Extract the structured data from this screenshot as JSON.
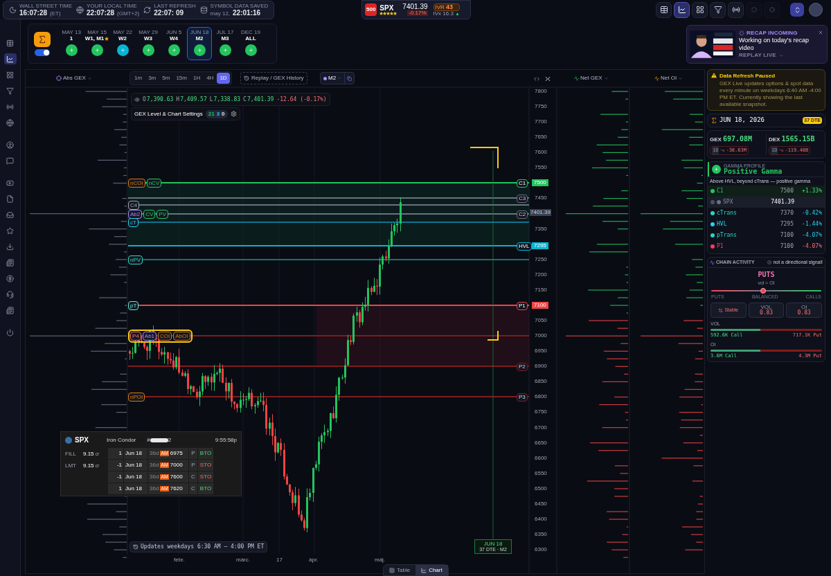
{
  "status_bar": {
    "clocks": [
      {
        "label": "WALL STREET TIME",
        "time": "16:07:28",
        "zone": "(ET)"
      },
      {
        "label": "YOUR LOCAL TIME",
        "time": "22:07:28",
        "zone": "(GMT+2)"
      },
      {
        "label": "LAST REFRESH",
        "time": "22:07: 09"
      },
      {
        "label": "SYMBOL DATA SAVED",
        "zone": "may 12,",
        "time": "22:01:16"
      }
    ]
  },
  "ticker": {
    "badge": "500",
    "symbol": "SPX",
    "stars": 5,
    "price": "7401.39",
    "change": "-0.17%",
    "ivr_label": "IVR",
    "ivr": "43",
    "ivx": "IVx 16.3",
    "ivx_arrow": "▲"
  },
  "toolbar": {
    "buttons": [
      {
        "selected": false,
        "disabled": false
      },
      {
        "selected": true,
        "disabled": false
      },
      {
        "selected": false,
        "disabled": false
      },
      {
        "selected": false,
        "disabled": false
      },
      {
        "selected": false,
        "disabled": false
      },
      {
        "selected": false,
        "disabled": true
      },
      {
        "selected": false,
        "disabled": true
      }
    ]
  },
  "sidebar": {
    "groups": [
      {
        "items": [
          {
            "selected": false
          },
          {
            "selected": true
          },
          {
            "selected": false
          },
          {
            "selected": false
          },
          {
            "selected": false
          },
          {
            "selected": false
          }
        ]
      },
      {
        "items": [
          {
            "selected": false
          },
          {
            "selected": false
          }
        ]
      },
      {
        "items": [
          {
            "selected": false
          },
          {
            "selected": false
          },
          {
            "selected": false
          },
          {
            "selected": false
          },
          {
            "selected": false
          },
          {
            "selected": false
          },
          {
            "selected": false
          },
          {
            "selected": false
          },
          {
            "selected": false
          }
        ]
      },
      {
        "items": [
          {
            "selected": false
          }
        ]
      }
    ]
  },
  "expiry_bar": {
    "toggle": {
      "on": true
    },
    "expiries": [
      {
        "date": "MAY 13",
        "label": "1",
        "starred": false,
        "selected": false,
        "color": "#22c55e"
      },
      {
        "date": "MAY 15",
        "label": "W1, M1",
        "starred": true,
        "selected": false,
        "color": "#22c55e"
      },
      {
        "date": "MAY 22",
        "label": "W2",
        "starred": false,
        "selected": false,
        "color": "#06b6d4"
      },
      {
        "date": "MAY 29",
        "label": "W3",
        "starred": false,
        "selected": false,
        "color": "#22c55e"
      },
      {
        "date": "JUN 5",
        "label": "W4",
        "starred": false,
        "selected": false,
        "color": "#22c55e"
      },
      {
        "date": "JUN 18",
        "label": "M2",
        "starred": false,
        "selected": true,
        "color": "#22c55e"
      },
      {
        "date": "JUL 17",
        "label": "M3",
        "starred": false,
        "selected": false,
        "color": "#22c55e"
      },
      {
        "date": "DEC 19",
        "label": "ALL",
        "starred": false,
        "selected": false,
        "color": "#22c55e"
      }
    ]
  },
  "recap": {
    "title": "RECAP INCOMING",
    "message": "Working on today's recap video",
    "link": "REPLAY LIVE →"
  },
  "chart": {
    "left_header": "Abs GEX",
    "timeframes": [
      {
        "label": "1m",
        "selected": false
      },
      {
        "label": "3m",
        "selected": false
      },
      {
        "label": "5m",
        "selected": false
      },
      {
        "label": "15m",
        "selected": false
      },
      {
        "label": "1H",
        "selected": false
      },
      {
        "label": "4H",
        "selected": false
      },
      {
        "label": "1D",
        "selected": true
      }
    ],
    "replay": "Replay / GEX History",
    "series": "M2",
    "right_headers": [
      "Net GEX",
      "Net OI"
    ],
    "ohlc": [
      {
        "key": "O",
        "value": "7,390.63"
      },
      {
        "key": "H",
        "value": "7,409.57"
      },
      {
        "key": "L",
        "value": "7,338.83"
      },
      {
        "key": "C",
        "value": "7,401.39"
      }
    ],
    "change": "-12.64 (-0.17%)",
    "settings": {
      "label": "GEX Level & Chart Settings",
      "counts": [
        {
          "value": "21",
          "kind": "green"
        },
        {
          "value": "3",
          "kind": "blue"
        },
        {
          "value": "0",
          "kind": "plain"
        }
      ]
    },
    "price_axis": [
      "7800",
      "7750",
      "7700",
      "7650",
      "7600",
      "7550",
      "7450",
      "7350",
      "7250",
      "7200",
      "7150",
      "7050",
      "7000",
      "6950",
      "6900",
      "6850",
      "6800",
      "6750",
      "6700",
      "6650",
      "6600",
      "6550",
      "6500",
      "6450",
      "6400",
      "6350",
      "6300"
    ],
    "current_price": "7401.39",
    "levels": [
      {
        "label": "C1",
        "price": "7500",
        "color": "#22c55e",
        "highlighted": false,
        "tags": [
          {
            "text": "nCOI",
            "color": "#d97706"
          },
          {
            "text": "nCV",
            "color": "#22c55e"
          }
        ]
      },
      {
        "label": "C3",
        "color": "#6b7280"
      },
      {
        "color": "#6b7280",
        "highlighted": false,
        "tags": [
          {
            "text": "C4",
            "color": "#9ca3af"
          }
        ]
      },
      {
        "label": "C2",
        "color": "#6b7280",
        "highlighted": false,
        "tags": [
          {
            "text": "Ab2",
            "color": "#a78bfa"
          },
          {
            "text": "CV",
            "color": "#22c55e"
          },
          {
            "text": "PV",
            "color": "#22c55e"
          }
        ]
      },
      {
        "color": "#0e7490",
        "highlighted": false,
        "tags": [
          {
            "text": "cT",
            "color": "#22d3ee"
          }
        ]
      },
      {
        "label": "HVL",
        "price": "7295",
        "color": "#06b6d4"
      },
      {
        "color": "#0f766e",
        "highlighted": false,
        "tags": [
          {
            "text": "nPV",
            "color": "#2dd4bf"
          }
        ]
      },
      {
        "label": "P1",
        "price": "7100",
        "color": "#ef4444",
        "highlighted": false,
        "tags": [
          {
            "text": "pT",
            "color": "#5eead4"
          }
        ]
      },
      {
        "color": "#7f1d1d",
        "highlighted": true,
        "tags": [
          {
            "text": "P4",
            "color": "#f87171"
          },
          {
            "text": "Ab1",
            "color": "#a78bfa"
          },
          {
            "text": "COI",
            "color": "#d97706"
          },
          {
            "text": "AbOI",
            "color": "#d97706"
          }
        ]
      },
      {
        "label": "P2",
        "color": "#7f1d1d"
      },
      {
        "label": "P3",
        "color": "#7f1d1d",
        "highlighted": false,
        "tags": [
          {
            "text": "nPOI",
            "color": "#d97706"
          }
        ]
      }
    ],
    "x_axis": [
      "febr.",
      "márc.",
      "17",
      "ápr.",
      "máj."
    ],
    "expiry_marker": {
      "date": "JUN 18",
      "sub": "37 DTE · M2"
    },
    "footer_note": "Updates weekdays 6:30 AM – 4:00 PM ET"
  },
  "order_ticket": {
    "symbol": "SPX",
    "strategy": "Iron Condor",
    "order_prefix": "#",
    "order_suffix": "2",
    "time": "9:55:58p",
    "prices": [
      {
        "label": "FILL",
        "value": "9.15",
        "unit": "cr"
      },
      {
        "label": "LMT",
        "value": "9.15",
        "unit": "cr"
      }
    ],
    "legs": [
      {
        "qty": "1",
        "date": "Jun 18",
        "dte": "36d",
        "session": "AM",
        "strike": "6975",
        "type": "P",
        "action": "BTO",
        "kind": "buy"
      },
      {
        "qty": "-1",
        "date": "Jun 18",
        "dte": "36d",
        "session": "AM",
        "strike": "7000",
        "type": "P",
        "action": "STO",
        "kind": "sell"
      },
      {
        "qty": "-1",
        "date": "Jun 18",
        "dte": "36d",
        "session": "AM",
        "strike": "7600",
        "type": "C",
        "action": "STO",
        "kind": "sell"
      },
      {
        "qty": "1",
        "date": "Jun 18",
        "dte": "36d",
        "session": "AM",
        "strike": "7620",
        "type": "C",
        "action": "BTO",
        "kind": "buy"
      }
    ]
  },
  "right_panel": {
    "alert": {
      "title": "Data Refresh Paused",
      "text": "GEX Live updates options & spot data every minute on weekdays 6:40 AM -4:00 PM ET. Currently showing the last available snapshot."
    },
    "expiry": {
      "date": "JUN 18, 2026",
      "dte": "37 DTE"
    },
    "metrics": [
      {
        "label": "GEX",
        "value": "697.08M",
        "period": "1D",
        "change": "-38.63M"
      },
      {
        "label": "DEX",
        "value": "1565.15B",
        "period": "1D",
        "change": "-119.48B"
      }
    ],
    "gamma": {
      "title": "GAMMA PROFILE",
      "state": "Positive Gamma",
      "note": "Above HVL, beyond cTrans — positive gamma",
      "rows": [
        {
          "kind": "level",
          "name": "C1",
          "value": "7500",
          "change": "+1.33%",
          "color": "#22c55e"
        },
        {
          "kind": "spot",
          "name": "SPX",
          "value": "7401.39",
          "color": "#6b7280"
        },
        {
          "kind": "level",
          "name": "cTrans",
          "value": "7370",
          "change": "-0.42%",
          "color": "#2dd4bf"
        },
        {
          "kind": "level",
          "name": "HVL",
          "value": "7295",
          "change": "-1.44%",
          "color": "#22d3ee"
        },
        {
          "kind": "level",
          "name": "pTrans",
          "value": "7100",
          "change": "-4.07%",
          "color": "#2dd4bf"
        },
        {
          "kind": "level",
          "name": "P1",
          "value": "7100",
          "change": "-4.07%",
          "color": "#f43f5e"
        }
      ]
    },
    "chain": {
      "title": "CHAIN ACTIVITY",
      "note": "not a directional signal!",
      "bias": "PUTS",
      "sub": "vol ≈ OI",
      "slider": {
        "level": 0.47,
        "labels": [
          "PUTS",
          "BALANCED",
          "CALLS"
        ]
      },
      "trend": "Stable",
      "ratios": [
        {
          "label": "VOL",
          "value": "0.83"
        },
        {
          "label": "OI",
          "value": "0.83"
        }
      ],
      "bars": [
        {
          "label": "VOL",
          "call": "592.6K Call",
          "put": "717.1K Put",
          "level": 0.45
        },
        {
          "label": "OI",
          "call": "3.6M Call",
          "put": "4.3M Put",
          "level": 0.45
        }
      ]
    }
  },
  "bottom_tabs": [
    {
      "label": "Table",
      "selected": false
    },
    {
      "label": "Chart",
      "selected": true
    }
  ]
}
